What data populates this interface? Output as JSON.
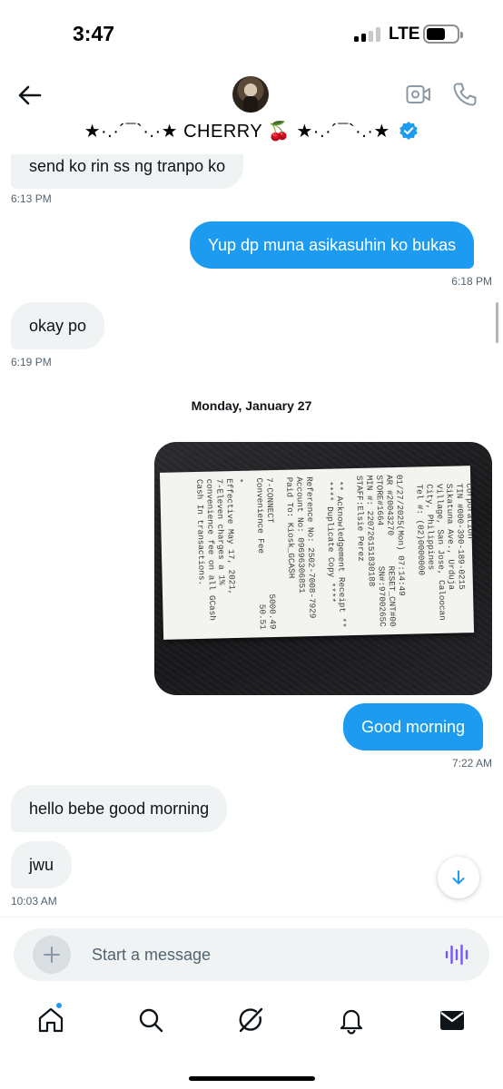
{
  "status_bar": {
    "time": "3:47",
    "network": "LTE",
    "signal_bars": 2,
    "signal_total": 4
  },
  "header": {
    "contact_name": "★·.·´¯`·.·★ CHERRY 🍒 ★·.·´¯`·.·★",
    "verified": true,
    "icons": {
      "back": "arrow-left-icon",
      "video": "video-camera-icon",
      "call": "phone-icon",
      "verified": "verified-badge-icon"
    }
  },
  "messages": [
    {
      "direction": "in",
      "text": "send ko rin ss ng tranpo ko",
      "time": "6:13 PM"
    },
    {
      "direction": "out",
      "text": "Yup dp muna asikasuhin ko bukas",
      "time": "6:18 PM"
    },
    {
      "direction": "in",
      "text": "okay po",
      "time": "6:19 PM"
    },
    {
      "direction": "out",
      "text": "Good morning",
      "time": "7:22 AM"
    },
    {
      "direction": "in",
      "text": "hello bebe good morning",
      "time": ""
    },
    {
      "direction": "in",
      "text": "jwu",
      "time": "10:03 AM"
    }
  ],
  "date_separator": "Monday, January 27",
  "receipt_lines": [
    "  Corporation",
    "  TIN #000-390-189-0215",
    "  Sikatuna Ave., Urduja",
    "  Village, San Jose, Caloocan",
    "  City, Philippines",
    "  Tel #: (02)0000000",
    "",
    "01/27/2025(Mon) 07:14:49",
    "AR #20043270      RESET_CNT#000",
    "STORE#1664        SN#:9700265C",
    "MIN #: 220726151830188",
    "STAFF:Elsie Perez",
    "",
    " ** Acknowledgement Receipt **",
    " **** Duplicate Copy ****",
    "",
    "Reference No: 2502-7008-7929",
    "Account No: 09696306851",
    "Paid To: Kiosk_GCASH",
    "",
    "7-CONNECT              5000.49",
    "Convenience Fee          50.51",
    "",
    "*",
    "Effective May 17, 2021,",
    "7-Eleven charges a 1%",
    "convenience fee on all GCash",
    "Cash In transactions."
  ],
  "composer": {
    "placeholder": "Start a message",
    "value": ""
  },
  "nav": {
    "items": [
      "home-icon",
      "search-icon",
      "grok-icon",
      "notifications-icon",
      "messages-icon"
    ],
    "active": "messages-icon"
  },
  "colors": {
    "accent": "#1d9bf0",
    "incoming_bubble": "#eff3f4",
    "timestamp": "#536471",
    "voice_icon": "#7856ff"
  }
}
